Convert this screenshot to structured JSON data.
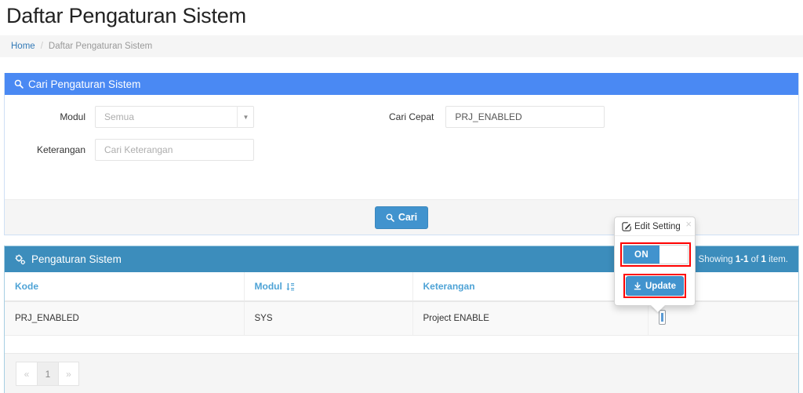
{
  "page": {
    "title": "Daftar Pengaturan Sistem"
  },
  "breadcrumb": {
    "home": "Home",
    "separator": "/",
    "current": "Daftar Pengaturan Sistem"
  },
  "search_panel": {
    "icon": "search-icon",
    "heading": "Cari Pengaturan Sistem",
    "fields": {
      "modul_label": "Modul",
      "modul_value": "Semua",
      "keterangan_label": "Keterangan",
      "keterangan_placeholder": "Cari Keterangan",
      "cari_cepat_label": "Cari Cepat",
      "cari_cepat_value": "PRJ_ENABLED"
    },
    "submit_button": {
      "label": "Cari",
      "icon": "search-icon"
    }
  },
  "grid_panel": {
    "icon": "gears-icon",
    "heading": "Pengaturan Sistem",
    "summary": {
      "prefix": "Showing ",
      "range": "1-1",
      "middle": " of ",
      "total": "1",
      "suffix": " item."
    },
    "columns": [
      {
        "label": "Kode",
        "sort_icon": ""
      },
      {
        "label": "Modul",
        "sort_icon": "sort-alpha-down-icon"
      },
      {
        "label": "Keterangan",
        "sort_icon": ""
      },
      {
        "label": "",
        "sort_icon": ""
      }
    ],
    "rows": [
      {
        "kode": "PRJ_ENABLED",
        "modul": "SYS",
        "keterangan": "Project ENABLE",
        "nilai": ""
      }
    ],
    "pagination": {
      "prev": "«",
      "pages": [
        "1"
      ],
      "next": "»",
      "active": "1"
    }
  },
  "popover": {
    "icon": "edit-square-icon",
    "title": "Edit Setting",
    "close_icon": "close-icon",
    "toggle": {
      "state_label": "ON",
      "highlight_color": "#ff0000"
    },
    "update_button": {
      "label": "Update",
      "icon": "download-icon",
      "highlight_color": "#ff0000"
    }
  },
  "colors": {
    "search_header_blue": "#4a89f3",
    "grid_header_blue": "#3c8dbc",
    "primary_button": "#4193ce",
    "link_blue": "#337ab7",
    "column_header_blue": "#4ea3d6",
    "highlight_red": "#ff0000"
  }
}
